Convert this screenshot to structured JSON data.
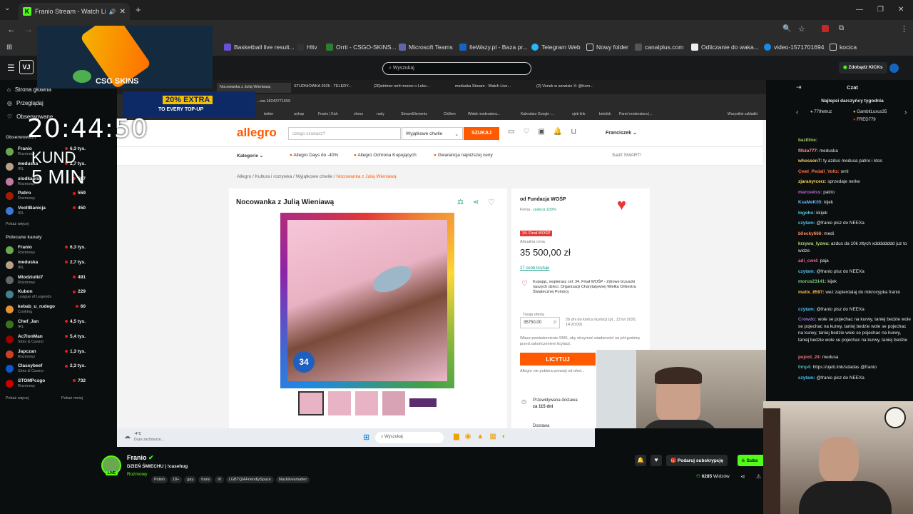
{
  "browser": {
    "tab_title": "Franio Stream - Watch Live",
    "bookmarks": [
      "Basketball live result...",
      "Hltv",
      "Orrti - CSGO-SKINS...",
      "Microsoft Teams",
      "IleWazy.pl - Baza pr...",
      "Telegram Web",
      "Nowy folder",
      "canalplus.com",
      "Odliczanie do waka...",
      "video-1571701694",
      "kocica"
    ],
    "colors": {
      "kick_green": "#53fc18",
      "allegro_orange": "#ff5a00",
      "live_red": "#e91916"
    }
  },
  "kick": {
    "logo": "VJ",
    "search_placeholder": "Wyszukaj",
    "get_kicks": "Zdobądź KICKs",
    "nav": [
      "Strona główna",
      "Przeglądaj",
      "Obserwowane"
    ],
    "followed_title": "Obserwowani",
    "followed": [
      {
        "name": "Franio",
        "cat": "Rozmowy",
        "viewers": "6,3 tys.",
        "color": "#6aa84f"
      },
      {
        "name": "meduska",
        "cat": "IRL",
        "viewers": "2,7 tys.",
        "color": "#b7a08a"
      },
      {
        "name": "slodkapisk",
        "cat": "Rozmowy",
        "viewers": "687",
        "color": "#c27ba0"
      },
      {
        "name": "Patiro",
        "cat": "Rozmowy",
        "viewers": "559",
        "color": "#a61c00"
      },
      {
        "name": "VooltBanicja",
        "cat": "IRL",
        "viewers": "450",
        "color": "#3c78d8"
      }
    ],
    "show_more": "Pokaż więcej",
    "recommended_title": "Polecane kanały",
    "recommended": [
      {
        "name": "Franio",
        "cat": "Rozmowy",
        "viewers": "6,3 tys.",
        "color": "#6aa84f"
      },
      {
        "name": "meduska",
        "cat": "IRL",
        "viewers": "2,7 tys.",
        "color": "#b7a08a"
      },
      {
        "name": "Mlodziutki7",
        "cat": "Rozmowy",
        "viewers": "491",
        "color": "#666"
      },
      {
        "name": "Kubon",
        "cat": "League of Legends",
        "viewers": "229",
        "color": "#45818e"
      },
      {
        "name": "kebab_u_rudego",
        "cat": "Cooking",
        "viewers": "60",
        "color": "#e69138"
      },
      {
        "name": "Chef_Jan",
        "cat": "IRL",
        "viewers": "4,5 tys.",
        "color": "#38761d"
      },
      {
        "name": "Ac7ionMan",
        "cat": "Slots & Casino",
        "viewers": "5,4 tys.",
        "color": "#990000"
      },
      {
        "name": "Japczan",
        "cat": "Rozmowy",
        "viewers": "1,3 tys.",
        "color": "#cc4125"
      },
      {
        "name": "Classybeef",
        "cat": "Slots & Casino",
        "viewers": "2,3 tys.",
        "color": "#1155cc"
      },
      {
        "name": "STOMPcsgo",
        "cat": "Rozmowy",
        "viewers": "732",
        "color": "#cc0000"
      }
    ],
    "show_more2": "Pokaż więcej",
    "show_less": "Pokaż mniej"
  },
  "overlay": {
    "timer": "20:44:50",
    "label1": "KUND",
    "label2": "5 MIN",
    "csgo_logo": "CSG SKINS",
    "promo": "20% EXTRA",
    "promo_sub": "TO EVERY TOP-UP"
  },
  "stream_browser": {
    "tabs": [
      "Nocowanka z Julią Wieniawą",
      "STUDNIÓWKA 2026 - TELEDY...",
      "(29)strimer orrti mocno o Leko...",
      "meduska Stream - Watch Live...",
      "(2) Venek w serwisie X: @horn..."
    ],
    "url": "...wa-18243771659",
    "bookmarks": [
      "twitter",
      "wykop",
      "Franio | Kick",
      "chess",
      "nudy",
      "StreamElements",
      "Chillem",
      "Widok moderatora...",
      "Kalendarz Google -...",
      "ujeb link",
      "betclick",
      "Panel moderatora |..."
    ],
    "all_bookmarks": "Wszystkie zakładki"
  },
  "allegro": {
    "logo": "allegro",
    "search_placeholder": "czego szukasz?",
    "category_select": "Wyjątkowe chwile",
    "search_button": "SZUKAJ",
    "user": "Franciszek",
    "nav": [
      "Kategorie",
      "Allegro Days do -40%",
      "Allegro Ochrona Kupujących",
      "Gwarancja najniższej ceny"
    ],
    "smart_label": "Sadź SMART!",
    "breadcrumbs": [
      "Allegro",
      "Kultura i rozrywka",
      "Wyjątkowe chwile",
      "Nocowanka z Julią Wieniawą"
    ],
    "product_title": "Nocowanka z Julią Wieniawą",
    "seller_prefix": "od Fundacja WOŚP",
    "seller_type": "Firma",
    "seller_rating": "poleca 100%",
    "badge": "34. Finał WOŚP",
    "price_label": "Aktualna cena",
    "price": "35 500,00 zł",
    "bidders": "27 osób licytuje",
    "charity_text": "Kupując, wspierasz cel: 34. Finał WOŚP - Zdrowe brzuszki naszych dzieci. Organizacji Charytatywnej Wielka Orkiestra Świątecznej Pomocy",
    "offer_label": "Twoja oferta",
    "offer_value": "35750,00",
    "offer_unit": "zł",
    "time_left": "26 dni do końca licytacji (pt., 13 lut 2026, 14:20:00)",
    "sms_text": "Włącz powiadomienie SMS, aby otrzymać wiadomość na pół godziny przed zakończeniem licytacji.",
    "bid_button": "LICYTUJ",
    "no_fee": "Allegro nie pobiera prowizji od ofert...",
    "delivery_label": "Przewidywana dostawa",
    "delivery_value": "za 115 dni",
    "dostawa": "Dostawa",
    "photo_badge": "34"
  },
  "taskbar": {
    "weather": "-4°C",
    "weather_desc": "Duże zachmurze...",
    "search": "Wyszukaj"
  },
  "chat": {
    "title": "Czat",
    "top_title": "Najlepsi darczyńcy tygodnia",
    "top": [
      {
        "name": "77thetruz",
        "n": "1"
      },
      {
        "name": "GambitLuxus35",
        "n": "1"
      },
      {
        "name": "FRED779",
        "n": "1"
      }
    ],
    "messages": [
      {
        "user": "bazillive:",
        "text": "",
        "color": "#9ccc65"
      },
      {
        "user": "fifcio777:",
        "text": "meduska",
        "color": "#ff9aa2"
      },
      {
        "user": "whosson7:",
        "text": "ty azdus medusa patiro i ktos",
        "color": "#ffcc66"
      },
      {
        "user": "Cwel_Pedall_Voltz:",
        "text": "orrti",
        "color": "#ff7043"
      },
      {
        "user": "zjaranyrcerz:",
        "text": "sprzedaje nerke",
        "color": "#ffd54f"
      },
      {
        "user": "marceelss:",
        "text": "patiro",
        "color": "#ba68c8"
      },
      {
        "user": "KsaMeK05:",
        "text": "kijek",
        "color": "#64b5f6"
      },
      {
        "user": "logoho:",
        "text": "kkijek",
        "color": "#4dd0e1"
      },
      {
        "user": "czytam:",
        "text": "@franio pisz do NEEXa",
        "color": "#4fc3f7"
      },
      {
        "user": "bilecky666:",
        "text": "medi",
        "color": "#ff8a65"
      },
      {
        "user": "krzywa_lyzwa:",
        "text": "azdus da 10k złtych xdddddddd juz to widze",
        "color": "#aed581"
      },
      {
        "user": "adi_cwel:",
        "text": "paja",
        "color": "#f06292"
      },
      {
        "user": "czytam:",
        "text": "@franio pisz do NEEXa",
        "color": "#4fc3f7"
      },
      {
        "user": "morus23141:",
        "text": "kijek",
        "color": "#81c784"
      },
      {
        "user": "matix_8597:",
        "text": "wez zapierdalaj do mikrocypka franio",
        "color": "#ffb74d"
      },
      {
        "user": "czytam:",
        "text": "@franio pisz do NEEXa",
        "color": "#4fc3f7"
      },
      {
        "user": "Crowdo:",
        "text": "wole se pojechac na kurwy, taniej bedzie wole se pojechac na kurwy, taniej bedzie wole se pojechac na kurwy, taniej bedzie wole se pojechac na kurwy, taniej bedzie wole se pojechac na kurwy, taniej bedzie",
        "color": "#9575cd"
      },
      {
        "user": "pejoot_24:",
        "text": "medusa",
        "color": "#e57373"
      },
      {
        "user": "0mp4:",
        "text": "https://ujeb.link/sdadas @franio",
        "color": "#4db6ac"
      },
      {
        "user": "czytam:",
        "text": "@franio pisz do NEEXa",
        "color": "#4fc3f7"
      }
    ]
  },
  "streamer": {
    "name": "Franio",
    "title": "DZIEŃ ŚMIECHU | !casehug",
    "category": "Rozmowy",
    "tags": [
      "Polish",
      "18+",
      "gay",
      "trans",
      "irl",
      "LGBTQIAFriendlySpace",
      "blacklivesmatter"
    ],
    "live_label": "LIVE",
    "subscribe_gift": "Podaruj subskrypcję",
    "subscribe": "Subs",
    "viewers": "6285",
    "viewers_label": "Widzów"
  }
}
